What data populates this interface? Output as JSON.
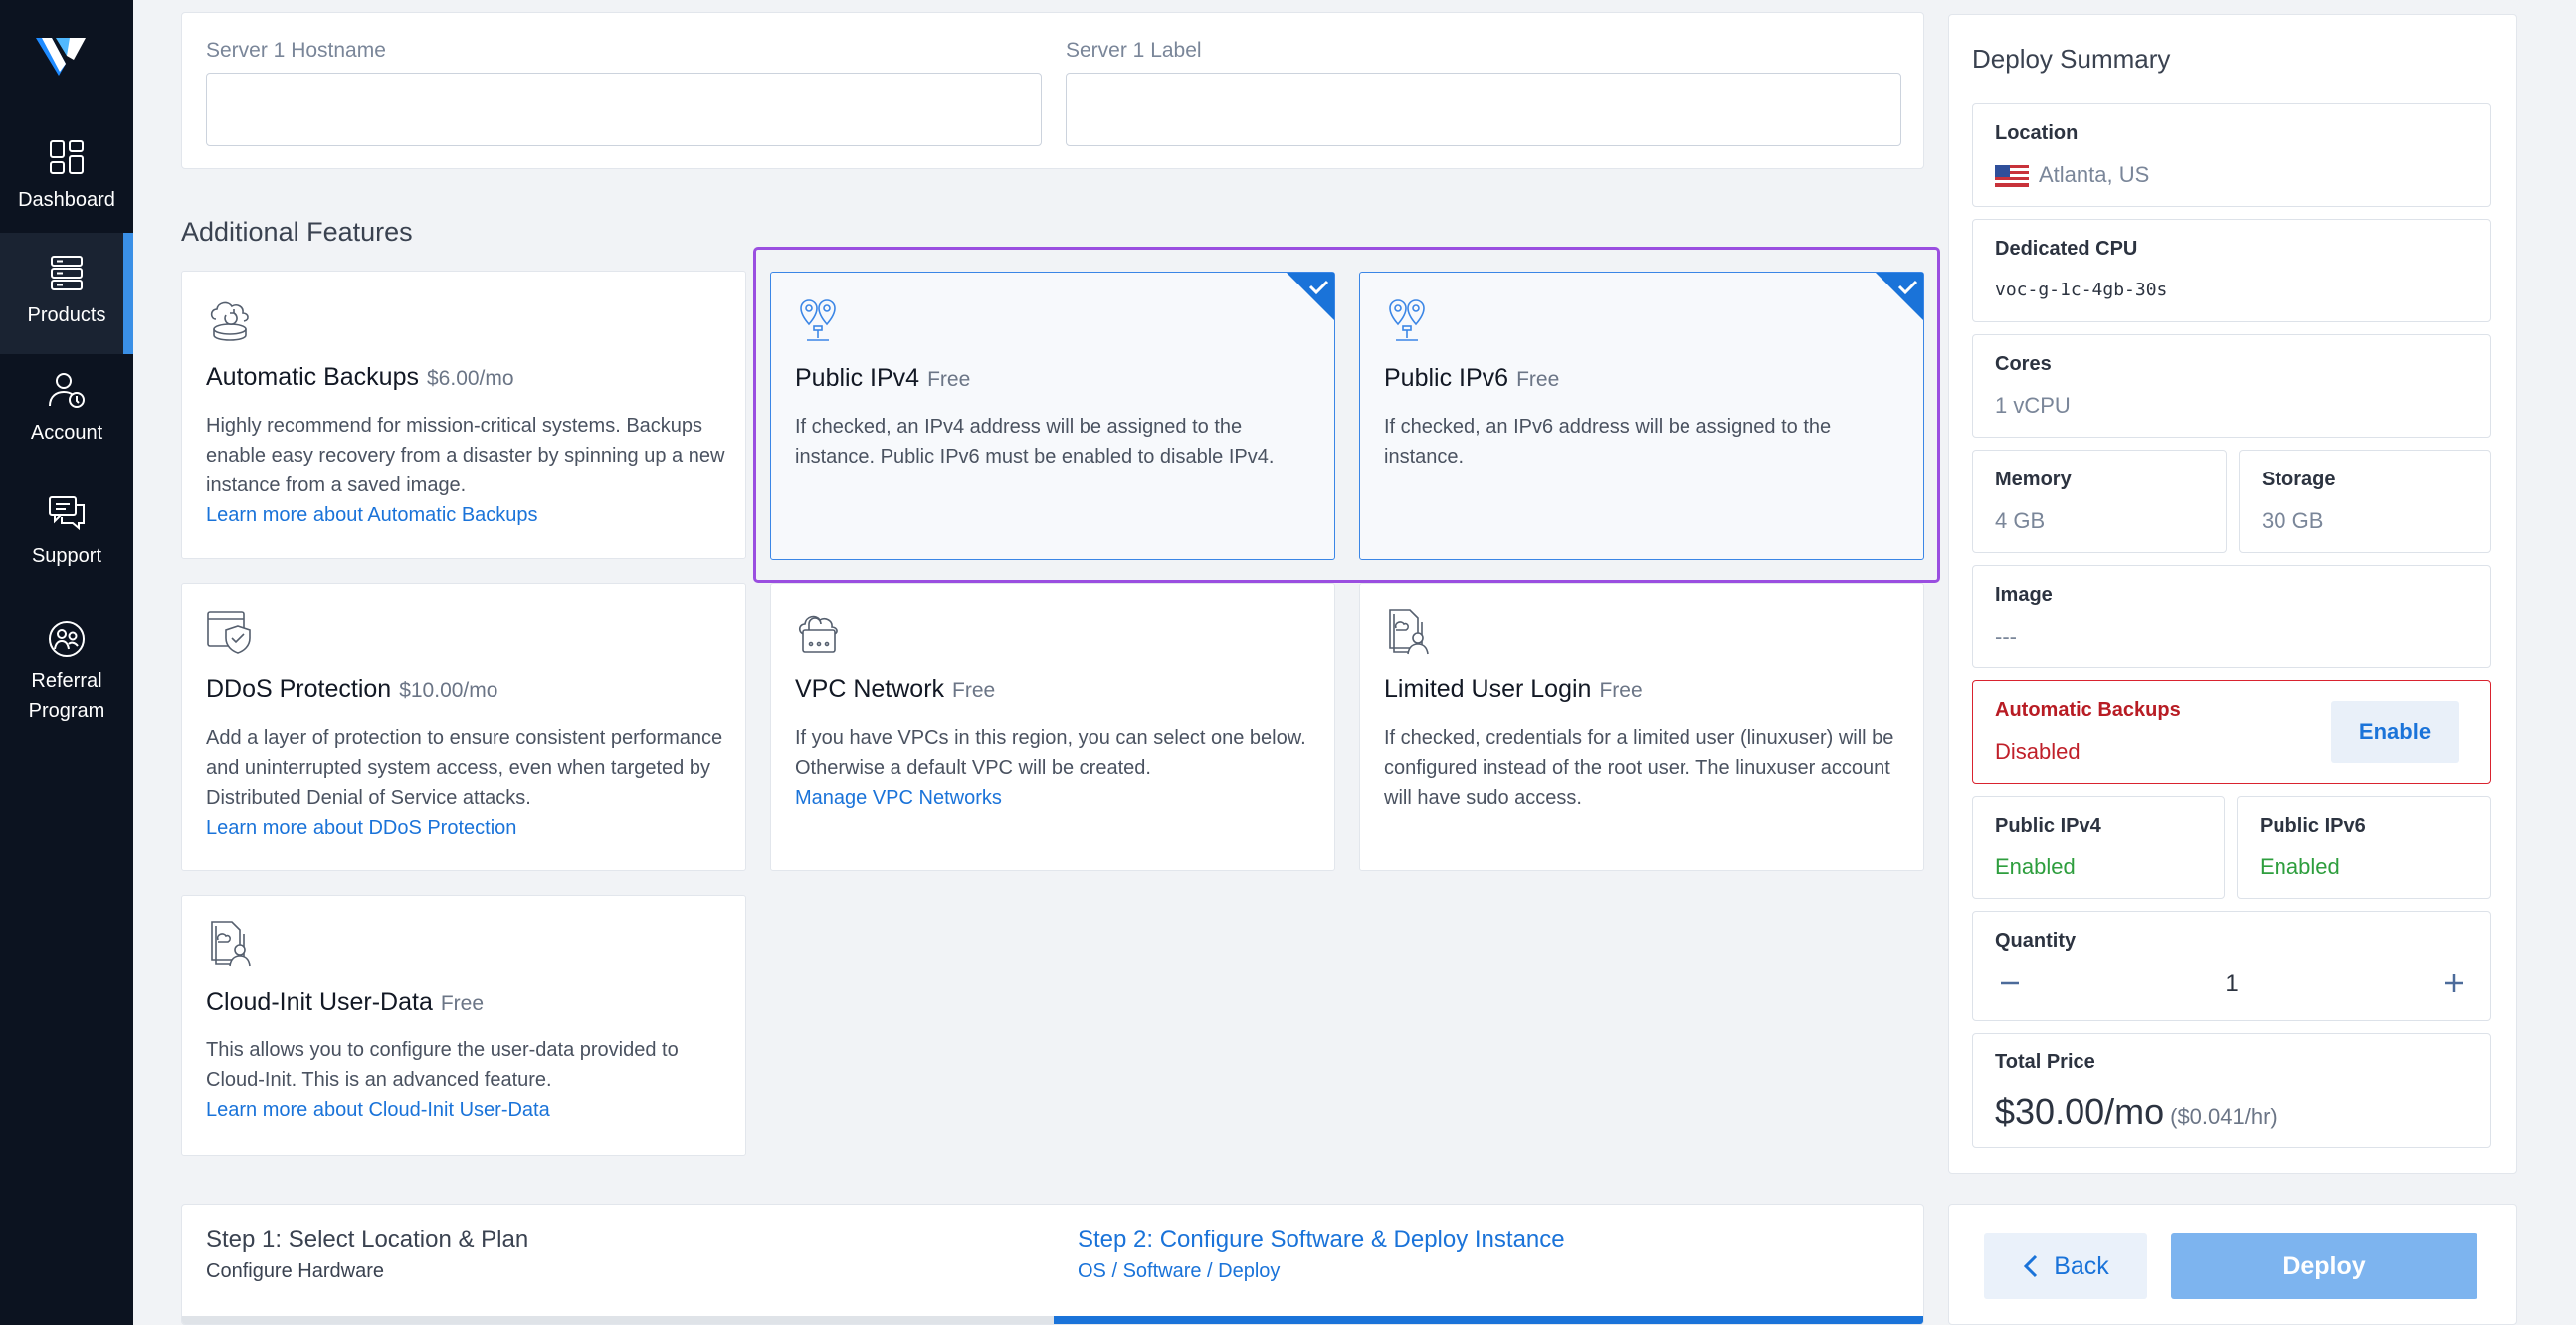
{
  "sidebar": {
    "items": [
      {
        "label": "Dashboard"
      },
      {
        "label": "Products"
      },
      {
        "label": "Account"
      },
      {
        "label": "Support"
      },
      {
        "label": "Referral Program"
      }
    ]
  },
  "server": {
    "hostname_label": "Server 1 Hostname",
    "hostname_value": "",
    "label_label": "Server 1 Label",
    "label_value": ""
  },
  "features": {
    "title": "Additional Features",
    "items": [
      {
        "title": "Automatic Backups",
        "price": "$6.00/mo",
        "desc": "Highly recommend for mission-critical systems. Backups enable easy recovery from a disaster by spinning up a new instance from a saved image.",
        "link": "Learn more about Automatic Backups",
        "selected": false
      },
      {
        "title": "Public IPv4",
        "price": "Free",
        "desc": "If checked, an IPv4 address will be assigned to the instance. Public IPv6 must be enabled to disable IPv4.",
        "link": "",
        "selected": true
      },
      {
        "title": "Public IPv6",
        "price": "Free",
        "desc": "If checked, an IPv6 address will be assigned to the instance.",
        "link": "",
        "selected": true
      },
      {
        "title": "DDoS Protection",
        "price": "$10.00/mo",
        "desc": "Add a layer of protection to ensure consistent performance and uninterrupted system access, even when targeted by Distributed Denial of Service attacks.",
        "link": "Learn more about DDoS Protection",
        "selected": false
      },
      {
        "title": "VPC Network",
        "price": "Free",
        "desc": "If you have VPCs in this region, you can select one below. Otherwise a default VPC will be created.",
        "link": "Manage VPC Networks",
        "selected": false
      },
      {
        "title": "Limited User Login",
        "price": "Free",
        "desc": "If checked, credentials for a limited user (linuxuser) will be configured instead of the root user. The linuxuser account will have sudo access.",
        "link": "",
        "selected": false
      },
      {
        "title": "Cloud-Init User-Data",
        "price": "Free",
        "desc": "This allows you to configure the user-data provided to Cloud-Init. This is an advanced feature.",
        "link": "Learn more about Cloud-Init User-Data",
        "selected": false
      }
    ]
  },
  "steps": [
    {
      "title": "Step 1: Select Location & Plan",
      "subtitle": "Configure Hardware",
      "active": false
    },
    {
      "title": "Step 2: Configure Software & Deploy Instance",
      "subtitle": "OS / Software / Deploy",
      "active": true
    }
  ],
  "summary": {
    "title": "Deploy Summary",
    "location_label": "Location",
    "location_value": "Atlanta, US",
    "cpu_label": "Dedicated CPU",
    "cpu_value": "voc-g-1c-4gb-30s",
    "cores_label": "Cores",
    "cores_value": "1 vCPU",
    "memory_label": "Memory",
    "memory_value": "4 GB",
    "storage_label": "Storage",
    "storage_value": "30 GB",
    "image_label": "Image",
    "image_value": "---",
    "backups_label": "Automatic Backups",
    "backups_value": "Disabled",
    "enable_label": "Enable",
    "ipv4_label": "Public IPv4",
    "ipv4_value": "Enabled",
    "ipv6_label": "Public IPv6",
    "ipv6_value": "Enabled",
    "quantity_label": "Quantity",
    "quantity_value": "1",
    "total_label": "Total Price",
    "total_value": "$30.00/mo",
    "total_hourly": "($0.041/hr)"
  },
  "actions": {
    "back_label": "Back",
    "deploy_label": "Deploy"
  },
  "colors": {
    "sidebar_bg": "#0c1320",
    "accent": "#1a73d9",
    "highlight": "#9a4ee0",
    "alert": "#d9232f",
    "success": "#2e9e3e"
  }
}
